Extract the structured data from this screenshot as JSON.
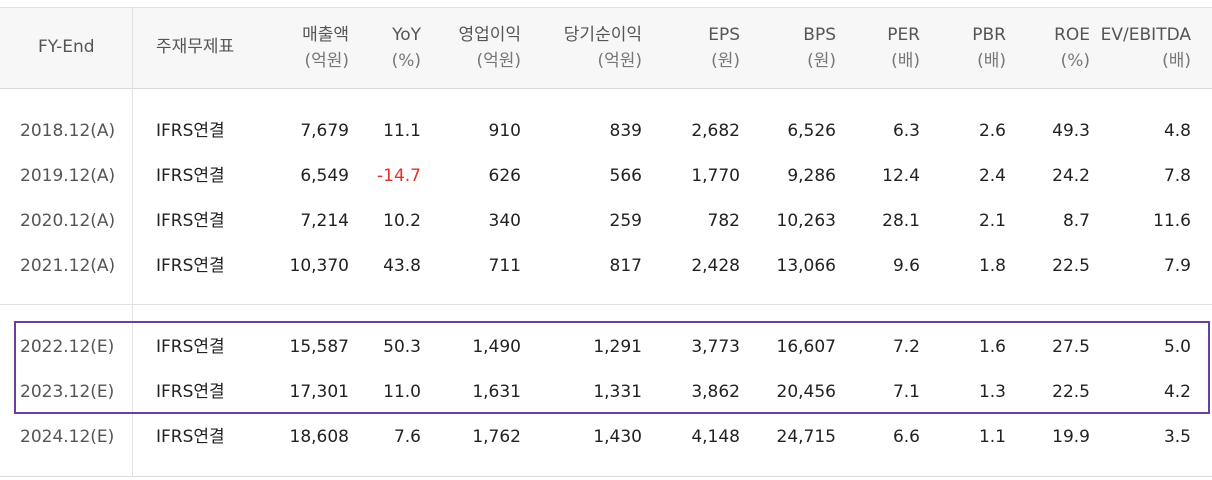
{
  "headers": [
    {
      "label": "FY-End",
      "sub": ""
    },
    {
      "label": "주재무제표",
      "sub": ""
    },
    {
      "label": "매출액",
      "sub": "(억원)"
    },
    {
      "label": "YoY",
      "sub": "(%)"
    },
    {
      "label": "영업이익",
      "sub": "(억원)"
    },
    {
      "label": "당기순이익",
      "sub": "(억원)"
    },
    {
      "label": "EPS",
      "sub": "(원)"
    },
    {
      "label": "BPS",
      "sub": "(원)"
    },
    {
      "label": "PER",
      "sub": "(배)"
    },
    {
      "label": "PBR",
      "sub": "(배)"
    },
    {
      "label": "ROE",
      "sub": "(%)"
    },
    {
      "label": "EV/EBITDA",
      "sub": "(배)"
    }
  ],
  "rows": [
    [
      "2018.12(A)",
      "IFRS연결",
      "7,679",
      "11.1",
      "910",
      "839",
      "2,682",
      "6,526",
      "6.3",
      "2.6",
      "49.3",
      "4.8"
    ],
    [
      "2019.12(A)",
      "IFRS연결",
      "6,549",
      "-14.7",
      "626",
      "566",
      "1,770",
      "9,286",
      "12.4",
      "2.4",
      "24.2",
      "7.8"
    ],
    [
      "2020.12(A)",
      "IFRS연결",
      "7,214",
      "10.2",
      "340",
      "259",
      "782",
      "10,263",
      "28.1",
      "2.1",
      "8.7",
      "11.6"
    ],
    [
      "2021.12(A)",
      "IFRS연결",
      "10,370",
      "43.8",
      "711",
      "817",
      "2,428",
      "13,066",
      "9.6",
      "1.8",
      "22.5",
      "7.9"
    ],
    [
      "2022.12(E)",
      "IFRS연결",
      "15,587",
      "50.3",
      "1,490",
      "1,291",
      "3,773",
      "16,607",
      "7.2",
      "1.6",
      "27.5",
      "5.0"
    ],
    [
      "2023.12(E)",
      "IFRS연결",
      "17,301",
      "11.0",
      "1,631",
      "1,331",
      "3,862",
      "20,456",
      "7.1",
      "1.3",
      "22.5",
      "4.2"
    ],
    [
      "2024.12(E)",
      "IFRS연결",
      "18,608",
      "7.6",
      "1,762",
      "1,430",
      "4,148",
      "24,715",
      "6.6",
      "1.1",
      "19.9",
      "3.5"
    ]
  ],
  "colors": {
    "negative": "#e8302a",
    "highlight_border": "#6a3fa0"
  }
}
